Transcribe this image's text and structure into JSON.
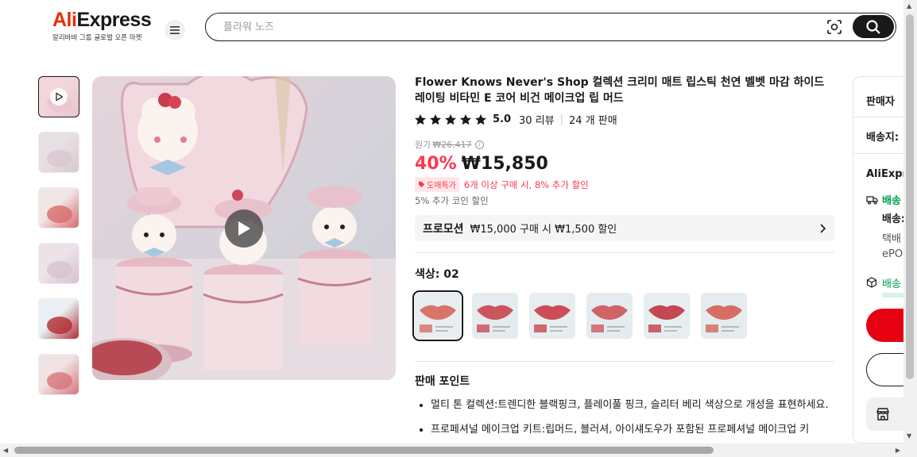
{
  "header": {
    "logo_text_a": "Ali",
    "logo_text_b": "Express",
    "logo_subtitle": "알리바바 그룹 글로벌 오픈 마켓",
    "menu_icon": "hamburger-icon",
    "search_placeholder": "플라워 노즈",
    "camera_icon": "camera-search-icon",
    "search_icon": "search-icon"
  },
  "thumbnails": [
    {
      "id": "video",
      "active": true,
      "colors": [
        "#f3d6dc",
        "#e8c4ce"
      ]
    },
    {
      "id": "2",
      "colors": [
        "#e7e0e4",
        "#d9c7cf"
      ]
    },
    {
      "id": "3",
      "colors": [
        "#f1e6e6",
        "#d86b6e"
      ]
    },
    {
      "id": "4",
      "colors": [
        "#ece3e9",
        "#d7c2d0"
      ]
    },
    {
      "id": "5",
      "colors": [
        "#e9eff3",
        "#b32b33"
      ]
    },
    {
      "id": "6",
      "colors": [
        "#efe3e3",
        "#d7757d"
      ]
    }
  ],
  "product": {
    "title": "Flower Knows Never's Shop 컬렉션 크리미 매트 립스틱 천연 벨벳 마감 하이드레이팅 비타민 E 코어 비건 메이크업 립 머드",
    "rating": "5.0",
    "reviews": "30 리뷰",
    "sold": "24 개 판매",
    "original_label": "원가",
    "original_price": "₩26,417",
    "discount": "40%",
    "price": "₩15,850",
    "wholesale_badge": "도매특가",
    "wholesale_text": "6개 이상 구매 시, 8% 추가 할인",
    "coin_text": "5% 추가 코인 할인",
    "promo_label": "프로모션",
    "promo_text": "₩15,000 구매 시 ₩1,500 할인",
    "color_label": "색상: 02",
    "swatches": [
      {
        "lip": "#d7756b",
        "bg": "#e8eef0",
        "selected": true
      },
      {
        "lip": "#c9565e",
        "bg": "#e4ecef"
      },
      {
        "lip": "#cc4d57",
        "bg": "#e6eef0"
      },
      {
        "lip": "#cf6468",
        "bg": "#e4ecef"
      },
      {
        "lip": "#c44852",
        "bg": "#e6eef0"
      },
      {
        "lip": "#d56f64",
        "bg": "#e4ecef"
      }
    ],
    "sell_points_title": "판매 포인트",
    "sell_points": [
      "멀티 톤 컬렉션:트렌디한 블랙핑크, 플레이풀 핑크, 슬리터 베리 색상으로 개성을 표현하세요.",
      "프로페셔널 메이크업 키트:립머드, 블러셔, 아이섀도우가 포함된 프로페셔널 메이크업 키"
    ]
  },
  "side": {
    "seller_label": "판매자",
    "ship_to_label": "배송지:",
    "aliexpress_label": "AliExpr",
    "delivery_green": "배송",
    "delivery_label": "배송:",
    "line1": "택배",
    "line2": "ePO",
    "line3": "배송",
    "truck_icon": "truck-icon",
    "box_icon": "box-icon",
    "store_icon": "store-icon"
  },
  "colors": {
    "brand_red": "#e62e04",
    "price_red": "#fd384f",
    "green": "#00a048"
  }
}
